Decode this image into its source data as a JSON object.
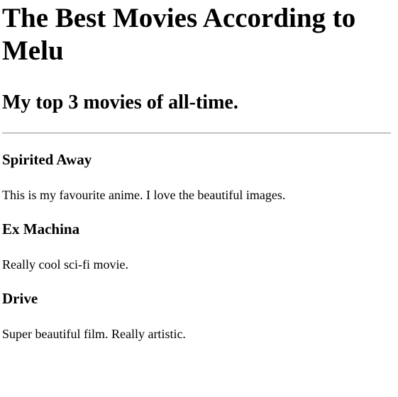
{
  "page": {
    "title": "The Best Movies According to Melu",
    "subtitle": "My top 3 movies of all-time."
  },
  "movies": [
    {
      "title": "Spirited Away",
      "description": "This is my favourite anime. I love the beautiful images."
    },
    {
      "title": "Ex Machina",
      "description": "Really cool sci-fi movie."
    },
    {
      "title": "Drive",
      "description": "Super beautiful film. Really artistic."
    }
  ]
}
